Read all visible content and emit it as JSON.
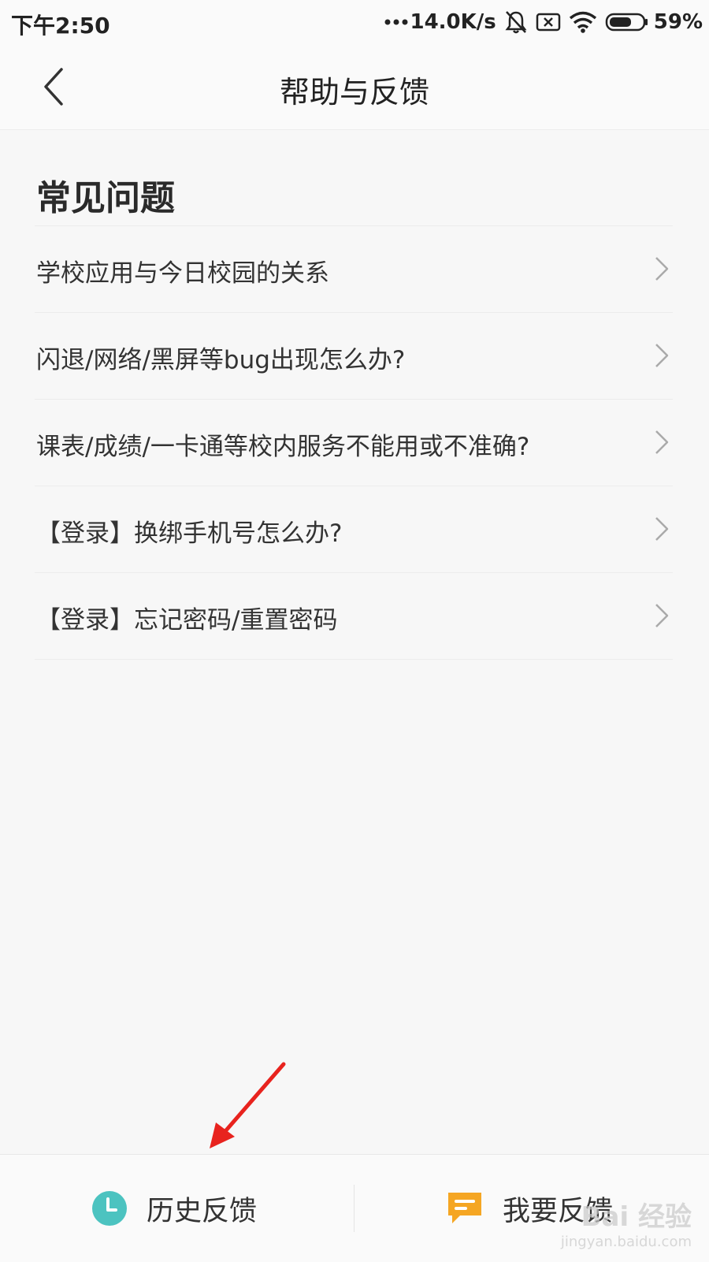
{
  "status_bar": {
    "time": "下午2:50",
    "network_speed": "14.0K/s",
    "battery": "59%",
    "icons": [
      "signal-dots-icon",
      "mute-bell-icon",
      "sim-x-icon",
      "wifi-icon",
      "battery-icon"
    ]
  },
  "nav": {
    "title": "帮助与反馈",
    "back_icon": "chevron-left-icon"
  },
  "faq": {
    "section_title": "常见问题",
    "items": [
      {
        "label": "学校应用与今日校园的关系"
      },
      {
        "label": "闪退/网络/黑屏等bug出现怎么办?"
      },
      {
        "label": "课表/成绩/一卡通等校内服务不能用或不准确?"
      },
      {
        "label": "【登录】换绑手机号怎么办?"
      },
      {
        "label": "【登录】忘记密码/重置密码"
      }
    ]
  },
  "bottom": {
    "history_label": "历史反馈",
    "feedback_label": "我要反馈"
  },
  "colors": {
    "history_icon": "#4cc3c0",
    "feedback_icon": "#f5a623",
    "annotation_arrow": "#e8231e"
  },
  "watermark": {
    "main": "Bai 经验",
    "sub": "jingyan.baidu.com"
  }
}
